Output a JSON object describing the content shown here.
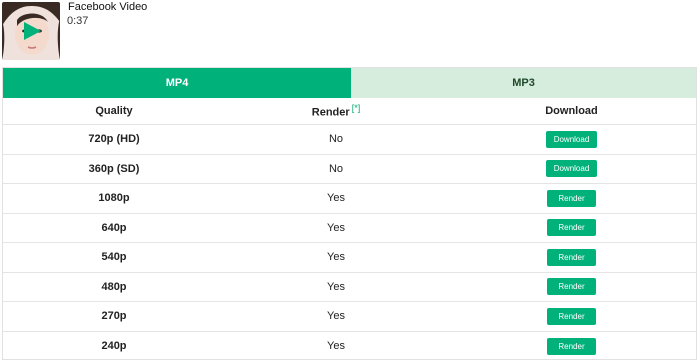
{
  "video": {
    "title": "Facebook Video",
    "duration": "0:37",
    "accent_color": "#00b27a",
    "play_icon": "play-triangle-icon"
  },
  "tabs": [
    {
      "label": "MP4",
      "active": true
    },
    {
      "label": "MP3",
      "active": false
    }
  ],
  "table": {
    "headers": {
      "quality": "Quality",
      "render": "Render",
      "render_note": "[*]",
      "download": "Download"
    },
    "rows": [
      {
        "quality": "720p (HD)",
        "render": "No",
        "action": "Download"
      },
      {
        "quality": "360p (SD)",
        "render": "No",
        "action": "Download"
      },
      {
        "quality": "1080p",
        "render": "Yes",
        "action": "Render"
      },
      {
        "quality": "640p",
        "render": "Yes",
        "action": "Render"
      },
      {
        "quality": "540p",
        "render": "Yes",
        "action": "Render"
      },
      {
        "quality": "480p",
        "render": "Yes",
        "action": "Render"
      },
      {
        "quality": "270p",
        "render": "Yes",
        "action": "Render"
      },
      {
        "quality": "240p",
        "render": "Yes",
        "action": "Render"
      }
    ]
  }
}
